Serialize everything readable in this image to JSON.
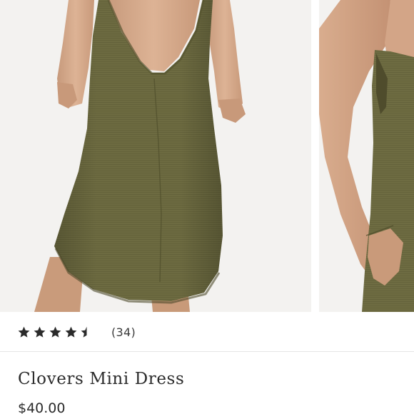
{
  "product": {
    "name": "Clovers Mini Dress",
    "price": "$40.00",
    "rating": 4.5,
    "rating_max": 5,
    "review_count": "(34)"
  },
  "gallery": {
    "images": [
      {
        "subject": "olive knit mini dress, back view with low v-back"
      },
      {
        "subject": "olive knit mini dress, side view with hand in pocket"
      }
    ]
  },
  "colors": {
    "dress_olive": "#6b6a3f",
    "star": "#2b2b2b",
    "text": "#2b2b2b",
    "divider": "#e5e5e5"
  }
}
